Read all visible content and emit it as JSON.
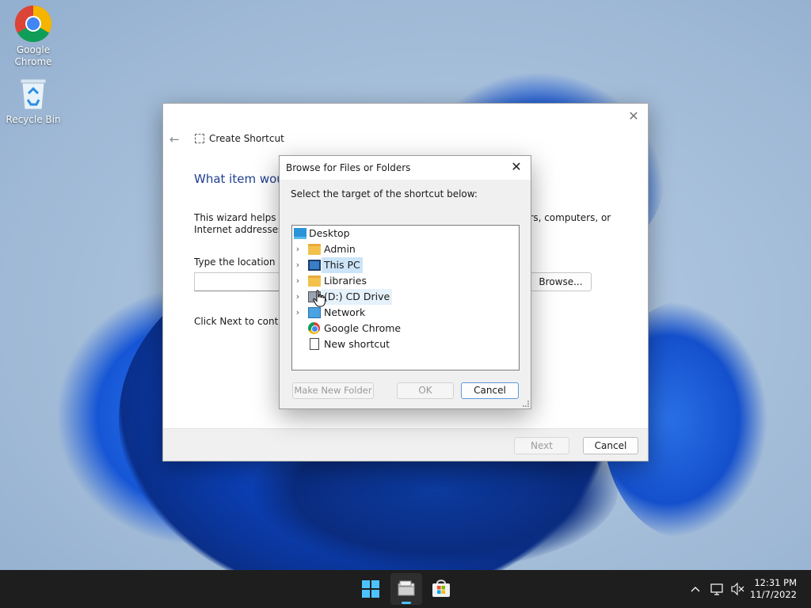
{
  "desktop": {
    "icons": [
      {
        "label": "Google Chrome"
      },
      {
        "label": "Recycle Bin"
      }
    ]
  },
  "wizard": {
    "title": "Create Shortcut",
    "heading": "What item woul",
    "description_left": "This wizard helps you",
    "description_left_line2": "Internet addresses.",
    "description_right": "ers, computers, or",
    "location_label": "Type the location of t",
    "browse_label": "Browse...",
    "next_instruction": "Click Next to continu",
    "next_label": "Next",
    "cancel_label": "Cancel"
  },
  "browse_dialog": {
    "title": "Browse for Files or Folders",
    "instruction": "Select the target of the shortcut below:",
    "tree": [
      {
        "label": "Desktop",
        "icon": "desktop-icon",
        "expandable": false,
        "level": 0
      },
      {
        "label": "Admin",
        "icon": "folder-icon",
        "expandable": true,
        "level": 1
      },
      {
        "label": "This PC",
        "icon": "computer-icon",
        "expandable": true,
        "level": 1,
        "state": "selected"
      },
      {
        "label": "Libraries",
        "icon": "folder-icon",
        "expandable": true,
        "level": 1
      },
      {
        "label": "(D:) CD Drive",
        "icon": "cd-drive-icon",
        "expandable": true,
        "level": 1,
        "state": "hover"
      },
      {
        "label": "Network",
        "icon": "network-icon",
        "expandable": true,
        "level": 1
      },
      {
        "label": "Google Chrome",
        "icon": "chrome-icon",
        "expandable": false,
        "level": 1
      },
      {
        "label": "New shortcut",
        "icon": "file-icon",
        "expandable": false,
        "level": 1
      }
    ],
    "make_folder_label": "Make New Folder",
    "ok_label": "OK",
    "cancel_label": "Cancel"
  },
  "taskbar": {
    "apps": [
      "start-icon",
      "file-explorer-icon",
      "microsoft-store-icon"
    ],
    "active_app": "file-explorer-icon",
    "clock_time": "12:31 PM",
    "clock_date": "11/7/2022"
  },
  "colors": {
    "accent": "#4cc2ff",
    "selection": "#cce4f7",
    "heading_blue": "#1f3f8f"
  }
}
